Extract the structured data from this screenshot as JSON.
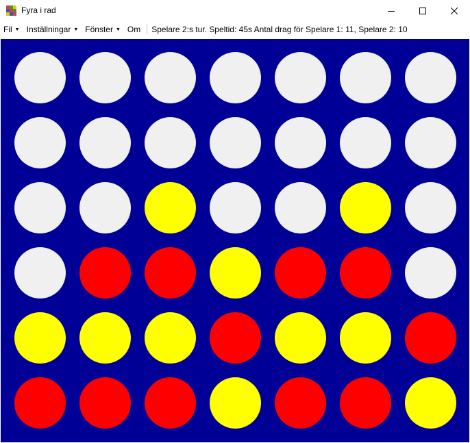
{
  "window": {
    "title": "Fyra i rad"
  },
  "menu": {
    "items": [
      {
        "label": "Fil",
        "dropdown": true
      },
      {
        "label": "Inställningar",
        "dropdown": true
      },
      {
        "label": "Fönster",
        "dropdown": true
      },
      {
        "label": "Om",
        "dropdown": false
      }
    ],
    "status_text": "Spelare 2:s tur. Speltid: 45s Antal drag för Spelare 1: 11, Spelare 2: 10"
  },
  "colors": {
    "board": "#000096",
    "empty": "#f0f0f0",
    "red": "#ff0000",
    "yellow": "#ffff00"
  },
  "board": {
    "rows": 6,
    "cols": 7,
    "cells": [
      [
        "empty",
        "empty",
        "empty",
        "empty",
        "empty",
        "empty",
        "empty"
      ],
      [
        "empty",
        "empty",
        "empty",
        "empty",
        "empty",
        "empty",
        "empty"
      ],
      [
        "empty",
        "empty",
        "yellow",
        "empty",
        "empty",
        "yellow",
        "empty"
      ],
      [
        "empty",
        "red",
        "red",
        "yellow",
        "red",
        "red",
        "empty"
      ],
      [
        "yellow",
        "yellow",
        "yellow",
        "red",
        "yellow",
        "yellow",
        "red"
      ],
      [
        "red",
        "red",
        "red",
        "yellow",
        "red",
        "red",
        "yellow"
      ]
    ]
  }
}
